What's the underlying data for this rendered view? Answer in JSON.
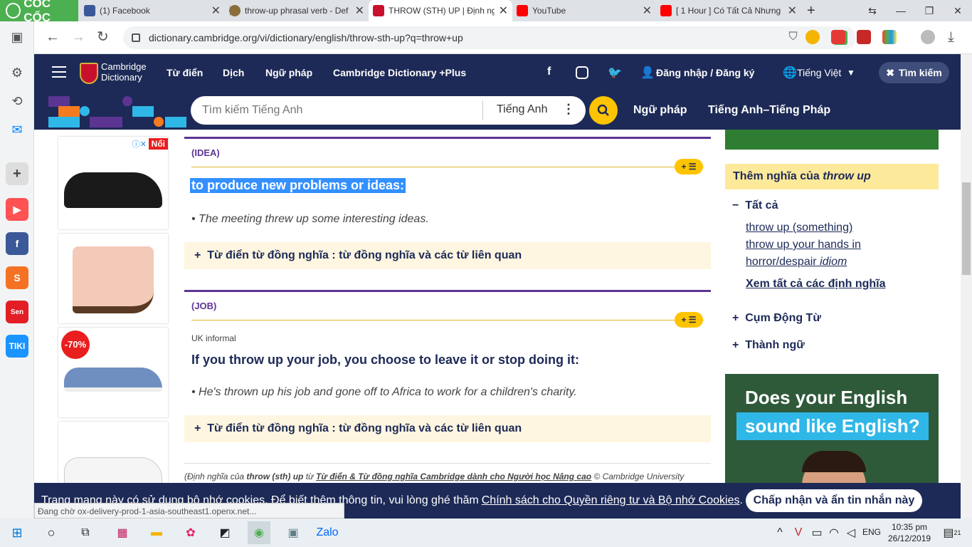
{
  "browser": {
    "brand": "CỐC CỐC",
    "tabs": [
      {
        "title": "(1) Facebook",
        "color": "#3b5998"
      },
      {
        "title": "throw-up phrasal verb - Def",
        "color": "#8a6d3b"
      },
      {
        "title": "THROW (STH) UP | Định ng",
        "color": "#c8102e"
      },
      {
        "title": "YouTube",
        "color": "#ff0000"
      },
      {
        "title": "[ 1 Hour ] Có Tất Cả Nhưng",
        "color": "#ff0000"
      }
    ],
    "url": "dictionary.cambridge.org/vi/dictionary/english/throw-sth-up?q=throw+up"
  },
  "site": {
    "logo": [
      "Cambridge",
      "Dictionary"
    ],
    "nav": [
      "Từ điển",
      "Dịch",
      "Ngữ pháp",
      "Cambridge Dictionary +Plus"
    ],
    "login": "Đăng nhập / Đăng ký",
    "language": "Tiếng Việt",
    "search_label": "Tìm kiếm",
    "search_placeholder": "Tìm kiếm Tiếng Anh",
    "search_lang": "Tiếng Anh",
    "subnav": [
      "Ngữ pháp",
      "Tiếng Anh–Tiếng Pháp"
    ]
  },
  "ads": {
    "badge": "Nổi",
    "discount": "-70%"
  },
  "entries": [
    {
      "guideword": "(IDEA)",
      "definition": "to produce new problems or ideas:",
      "example": "• The meeting threw up some interesting ideas.",
      "thesaurus": "Từ điển từ đồng nghĩa : từ đồng nghĩa và các từ liên quan"
    },
    {
      "guideword": "(JOB)",
      "label": "UK informal",
      "definition": "If you throw up your job, you choose to leave it or stop doing it:",
      "example": "• He's thrown up his job and gone off to Africa to work for a children's charity.",
      "thesaurus": "Từ điển từ đồng nghĩa : từ đồng nghĩa và các từ liên quan"
    }
  ],
  "footer_note": {
    "prefix": "(Định nghĩa của ",
    "headword": "throw (sth) up",
    "mid": " từ ",
    "source": "Từ điển & Từ đồng nghĩa Cambridge dành cho Người học Nâng cao",
    "suffix": " © Cambridge University"
  },
  "sidebar": {
    "more_prefix": "Thêm nghĩa của ",
    "more_word": "throw up",
    "all": "Tất cả",
    "links": [
      "throw up (something)",
      "throw up your hands in",
      "horror/despair"
    ],
    "idiom": "idiom",
    "see_all": "Xem tất cả các định nghĩa",
    "phrasal": "Cụm Động Từ",
    "idioms": "Thành ngữ"
  },
  "promo": {
    "line1": "Does your English",
    "line2": "sound like English?"
  },
  "cookie": {
    "text": "Trang mạng này có sử dụng bộ nhớ cookies. Để biết thêm thông tin, vui lòng ghé thăm",
    "link": "Chính sách cho Quyền riêng tư và Bộ nhớ Cookies",
    "accept": "Chấp nhận và ẩn tin nhắn này"
  },
  "status": "Đang chờ ox-delivery-prod-1-asia-southeast1.openx.net...",
  "taskbar": {
    "lang": "ENG",
    "time": "10:35 pm",
    "date": "26/12/2019",
    "notif": "21"
  }
}
